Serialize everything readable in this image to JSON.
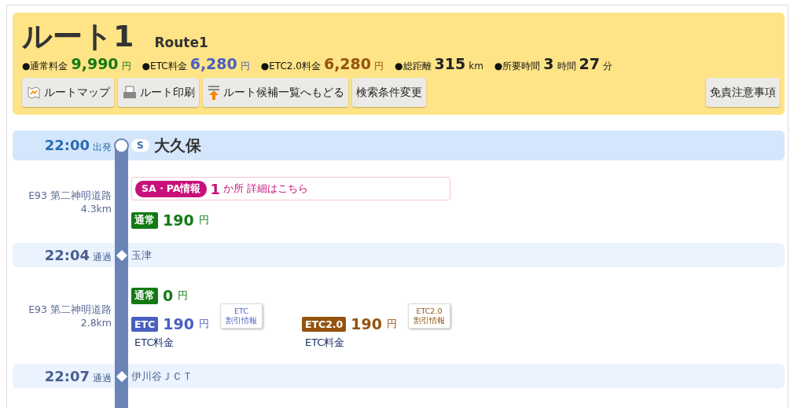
{
  "header": {
    "title": "ルート1",
    "subtitle": "Route1",
    "summary": [
      {
        "label": "●通常料金",
        "kind": "normal",
        "parts": [
          {
            "text": "9,990",
            "kind": "num"
          },
          {
            "text": "円",
            "kind": "unit"
          }
        ]
      },
      {
        "label": "●ETC料金",
        "kind": "etc",
        "parts": [
          {
            "text": "6,280",
            "kind": "num"
          },
          {
            "text": "円",
            "kind": "unit"
          }
        ]
      },
      {
        "label": "●ETC2.0料金",
        "kind": "etc2",
        "parts": [
          {
            "text": "6,280",
            "kind": "num"
          },
          {
            "text": "円",
            "kind": "unit"
          }
        ]
      },
      {
        "label": "●総距離",
        "kind": "plain",
        "parts": [
          {
            "text": "315",
            "kind": "num"
          },
          {
            "text": "km",
            "kind": "unit"
          }
        ]
      },
      {
        "label": "●所要時間",
        "kind": "plain",
        "parts": [
          {
            "text": "3",
            "kind": "num"
          },
          {
            "text": "時間",
            "kind": "unit"
          },
          {
            "text": "27",
            "kind": "num"
          },
          {
            "text": "分",
            "kind": "unit"
          }
        ]
      }
    ],
    "buttons": [
      {
        "label": "ルートマップ",
        "kind": "map"
      },
      {
        "label": "ルート印刷",
        "kind": "print"
      },
      {
        "label": "ルート候補一覧へもどる",
        "kind": "back"
      },
      {
        "label": "検索条件変更",
        "kind": "plain"
      }
    ],
    "disclaimer_button": "免責注意事項"
  },
  "timeline": [
    {
      "kind": "start",
      "time": "22:00",
      "action": "出発",
      "badge": "S",
      "name": "大久保"
    },
    {
      "kind": "segment",
      "road": "E93 第二神明道路",
      "distance": "4.3km",
      "sapa": {
        "tag": "SA・PA情報",
        "count": "1",
        "unit": "か所",
        "link": "詳細はこちら"
      },
      "fee_rows": [
        [
          {
            "kind": "normal",
            "tag": "通常",
            "amount": "190",
            "unit": "円"
          }
        ]
      ]
    },
    {
      "kind": "pass",
      "time": "22:04",
      "action": "通過",
      "name": "玉津"
    },
    {
      "kind": "segment",
      "road": "E93 第二神明道路",
      "distance": "2.8km",
      "fee_rows": [
        [
          {
            "kind": "normal",
            "tag": "通常",
            "amount": "0",
            "unit": "円"
          }
        ],
        [
          {
            "kind": "etc",
            "tag": "ETC",
            "amount": "190",
            "unit": "円",
            "discount": [
              "ETC",
              "割引情報"
            ],
            "caption": "ETC料金"
          },
          {
            "kind": "etc2",
            "tag": "ETC2.0",
            "amount": "190",
            "unit": "円",
            "discount": [
              "ETC2.0",
              "割引情報"
            ],
            "caption": "ETC料金"
          }
        ]
      ]
    },
    {
      "kind": "pass",
      "time": "22:07",
      "action": "通過",
      "name": "伊川谷ＪＣＴ"
    }
  ]
}
